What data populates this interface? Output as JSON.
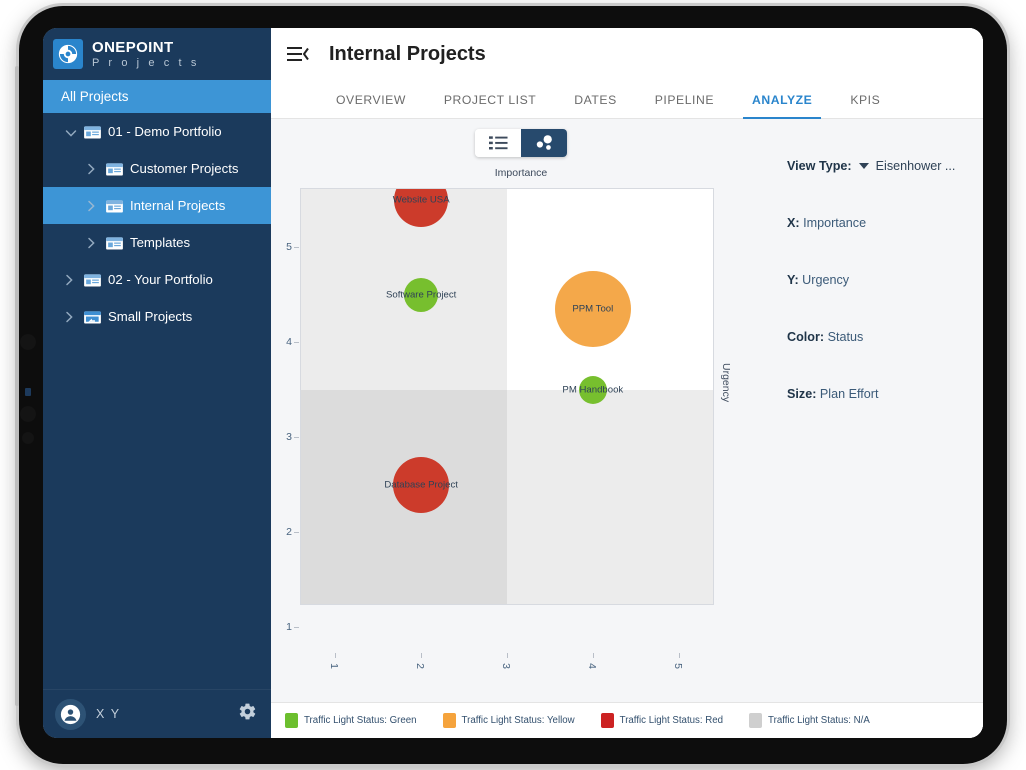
{
  "brand": {
    "name_top": "ONEPOINT",
    "name_bottom": "P r o j e c t s",
    "logo_icon": "onepoint-logo-icon"
  },
  "sidebar": {
    "all_projects_label": "All Projects",
    "tree": [
      {
        "label": "01 - Demo Portfolio",
        "indent": 0,
        "expanded": true,
        "selected": false,
        "icon": "folder-icon"
      },
      {
        "label": "Customer Projects",
        "indent": 1,
        "expanded": false,
        "selected": false,
        "icon": "folder-icon"
      },
      {
        "label": "Internal Projects",
        "indent": 1,
        "expanded": false,
        "selected": true,
        "icon": "folder-icon"
      },
      {
        "label": "Templates",
        "indent": 1,
        "expanded": false,
        "selected": false,
        "icon": "folder-icon"
      },
      {
        "label": "02 - Your Portfolio",
        "indent": 0,
        "expanded": false,
        "selected": false,
        "icon": "folder-icon"
      },
      {
        "label": "Small Projects",
        "indent": 0,
        "expanded": false,
        "selected": false,
        "icon": "folder-shared-icon"
      }
    ],
    "user": {
      "name": "X Y",
      "avatar_icon": "account-circle-icon",
      "settings_icon": "gear-icon"
    }
  },
  "header": {
    "menu_icon": "collapse-menu-icon",
    "title": "Internal Projects",
    "tabs": [
      {
        "label": "OVERVIEW",
        "active": false
      },
      {
        "label": "PROJECT LIST",
        "active": false
      },
      {
        "label": "DATES",
        "active": false
      },
      {
        "label": "PIPELINE",
        "active": false
      },
      {
        "label": "ANALYZE",
        "active": true
      },
      {
        "label": "KPIS",
        "active": false
      }
    ]
  },
  "view_toggle": {
    "list_icon": "list-view-icon",
    "bubble_icon": "bubble-chart-icon",
    "active": "bubble"
  },
  "settings_panel": {
    "view_type_label": "View Type:",
    "view_type_value": "Eisenhower ...",
    "dropdown_icon": "chevron-down-icon",
    "mappings": [
      {
        "key": "X:",
        "value": "Importance"
      },
      {
        "key": "Y:",
        "value": "Urgency"
      },
      {
        "key": "Color:",
        "value": "Status"
      },
      {
        "key": "Size:",
        "value": "Plan Effort"
      }
    ]
  },
  "legend": {
    "items": [
      {
        "label": "Traffic Light Status: Green",
        "color": "#6cbf2e"
      },
      {
        "label": "Traffic Light Status: Yellow",
        "color": "#f5a33c"
      },
      {
        "label": "Traffic Light Status: Red",
        "color": "#cc2222"
      },
      {
        "label": "Traffic Light Status: N/A",
        "color": "#cfcfcf"
      }
    ]
  },
  "chart_data": {
    "type": "scatter",
    "title": "Importance",
    "xlabel": "Importance",
    "ylabel": "Urgency",
    "xlim": [
      0.6,
      5.4
    ],
    "ylim": [
      0.75,
      5.12
    ],
    "xticks": [
      1,
      2,
      3,
      4,
      5
    ],
    "yticks": [
      1,
      2,
      3,
      4,
      5
    ],
    "grid": false,
    "legend_position": "bottom",
    "quadrant_divider": {
      "x": 3,
      "y": 3
    },
    "quadrant_colors": {
      "top_left": "#ececec",
      "top_right": "#ffffff",
      "bottom_left": "#dcdcdc",
      "bottom_right": "#ececec"
    },
    "points": [
      {
        "label": "Website USA",
        "x": 2.0,
        "y": 5.0,
        "size": 27,
        "color": "#cc3b2b",
        "status": "Red"
      },
      {
        "label": "Software Project",
        "x": 2.0,
        "y": 4.0,
        "size": 17,
        "color": "#77bf2e",
        "status": "Green"
      },
      {
        "label": "PPM Tool",
        "x": 4.0,
        "y": 3.86,
        "size": 38,
        "color": "#f4a84a",
        "status": "Yellow"
      },
      {
        "label": "PM Handbook",
        "x": 4.0,
        "y": 3.0,
        "size": 14,
        "color": "#77bf2e",
        "status": "Green"
      },
      {
        "label": "Database Project",
        "x": 2.0,
        "y": 2.0,
        "size": 28,
        "color": "#cc3b2b",
        "status": "Red"
      }
    ]
  }
}
